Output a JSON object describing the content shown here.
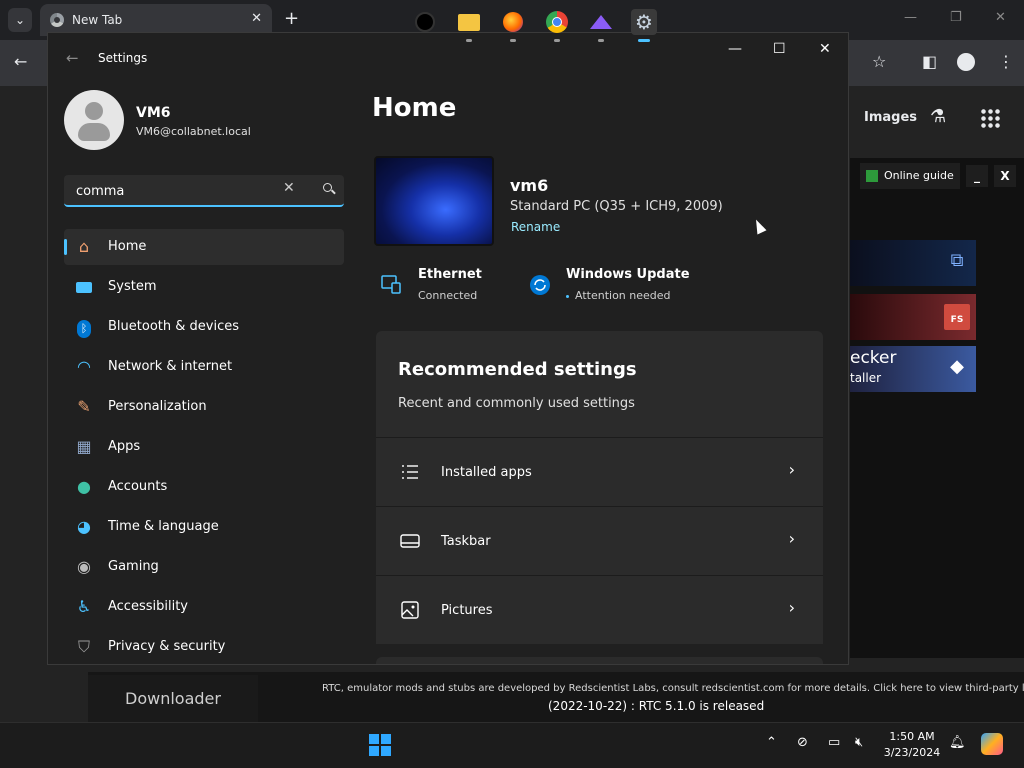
{
  "browser": {
    "tab_title": "New Tab",
    "tab_close": "✕",
    "new_tab": "+",
    "images_link": "Images"
  },
  "rtc": {
    "online_guide": "Online guide",
    "minimize": "_",
    "close": "X",
    "banner1_text": "",
    "banner3_title": "ecker",
    "banner3_sub": "taller",
    "banner2_badge": "FS",
    "downloader": "Downloader",
    "note": "RTC, emulator mods and stubs are developed by Redscientist Labs, consult redscientist.com for more details. Click here to view third-party licenses.",
    "release": "(2022-10-22) : RTC 5.1.0 is released"
  },
  "settings": {
    "window_title": "Settings",
    "user_name": "VM6",
    "user_email": "VM6@collabnet.local",
    "search_value": "comma",
    "nav": [
      {
        "label": "Home",
        "icon": "home-icon",
        "active": true
      },
      {
        "label": "System",
        "icon": "monitor-icon"
      },
      {
        "label": "Bluetooth & devices",
        "icon": "bluetooth-icon"
      },
      {
        "label": "Network & internet",
        "icon": "wifi-icon"
      },
      {
        "label": "Personalization",
        "icon": "brush-icon"
      },
      {
        "label": "Apps",
        "icon": "apps-icon"
      },
      {
        "label": "Accounts",
        "icon": "person-icon"
      },
      {
        "label": "Time & language",
        "icon": "globe-clock-icon"
      },
      {
        "label": "Gaming",
        "icon": "gamepad-icon"
      },
      {
        "label": "Accessibility",
        "icon": "accessibility-icon"
      },
      {
        "label": "Privacy & security",
        "icon": "shield-icon"
      }
    ],
    "home": {
      "heading": "Home",
      "pc_name": "vm6",
      "pc_model": "Standard PC (Q35 + ICH9, 2009)",
      "rename": "Rename",
      "ethernet_title": "Ethernet",
      "ethernet_status": "Connected",
      "update_title": "Windows Update",
      "update_status": "Attention needed",
      "rec_title": "Recommended settings",
      "rec_subtitle": "Recent and commonly used settings",
      "rec_items": [
        {
          "label": "Installed apps",
          "icon": "list-icon"
        },
        {
          "label": "Taskbar",
          "icon": "taskbar-icon"
        },
        {
          "label": "Pictures",
          "icon": "picture-icon"
        }
      ]
    }
  },
  "taskbar": {
    "time": "1:50 AM",
    "date": "3/23/2024"
  },
  "colors": {
    "accent": "#4cc2ff",
    "settings_bg": "#202020",
    "card_bg": "#2b2b2b"
  }
}
